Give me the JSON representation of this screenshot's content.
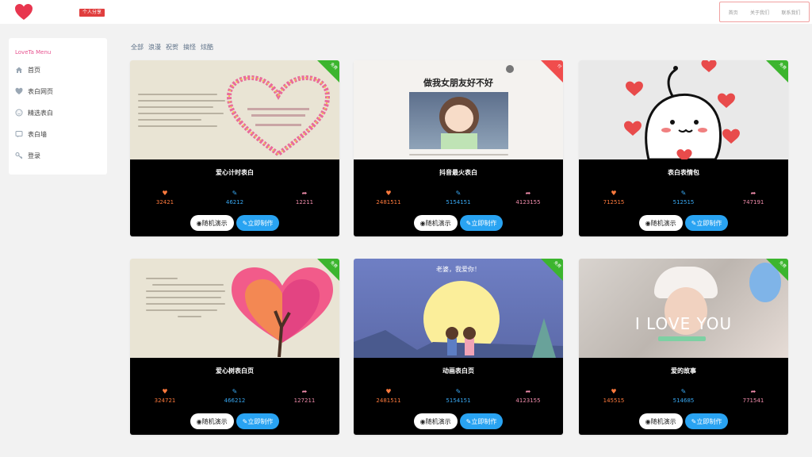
{
  "header": {
    "badge": "个人分享",
    "nav": [
      "首页",
      "关于我们",
      "联系我们"
    ],
    "brand_color": "#e8364f"
  },
  "sidebar": {
    "title": "LoveTa Menu",
    "items": [
      {
        "label": "首页",
        "icon": "home-icon"
      },
      {
        "label": "表白网页",
        "icon": "heart-icon"
      },
      {
        "label": "精选表白",
        "icon": "smile-icon"
      },
      {
        "label": "表白墙",
        "icon": "chat-icon"
      },
      {
        "label": "登录",
        "icon": "key-icon"
      }
    ]
  },
  "filters": [
    "全部",
    "浪漫",
    "祝贺",
    "搞怪",
    "炫酷"
  ],
  "buttons": {
    "demo": "随机演示",
    "make": "立即制作"
  },
  "cards": [
    {
      "title": "爱心计时表白",
      "likes": "32421",
      "edits": "46212",
      "shares": "12211",
      "ribbon": "免费",
      "ribbon_color": "#3cb52e"
    },
    {
      "title": "抖音最火表白",
      "likes": "2481511",
      "edits": "5154151",
      "shares": "4123155",
      "ribbon": "付",
      "ribbon_color": "#f04d4d",
      "thumb_text": "做我女朋友好不好"
    },
    {
      "title": "表白表情包",
      "likes": "712515",
      "edits": "512515",
      "shares": "747191",
      "ribbon": "免费",
      "ribbon_color": "#3cb52e"
    },
    {
      "title": "爱心树表白页",
      "likes": "324721",
      "edits": "466212",
      "shares": "127211",
      "ribbon": "免费",
      "ribbon_color": "#3cb52e"
    },
    {
      "title": "动画表白页",
      "likes": "2481511",
      "edits": "5154151",
      "shares": "4123155",
      "ribbon": "免费",
      "ribbon_color": "#3cb52e",
      "thumb_text": "老婆，我爱你！"
    },
    {
      "title": "爱的故事",
      "likes": "145515",
      "edits": "514685",
      "shares": "771541",
      "ribbon": "免费",
      "ribbon_color": "#3cb52e",
      "thumb_text": "I LOVE YOU"
    }
  ]
}
